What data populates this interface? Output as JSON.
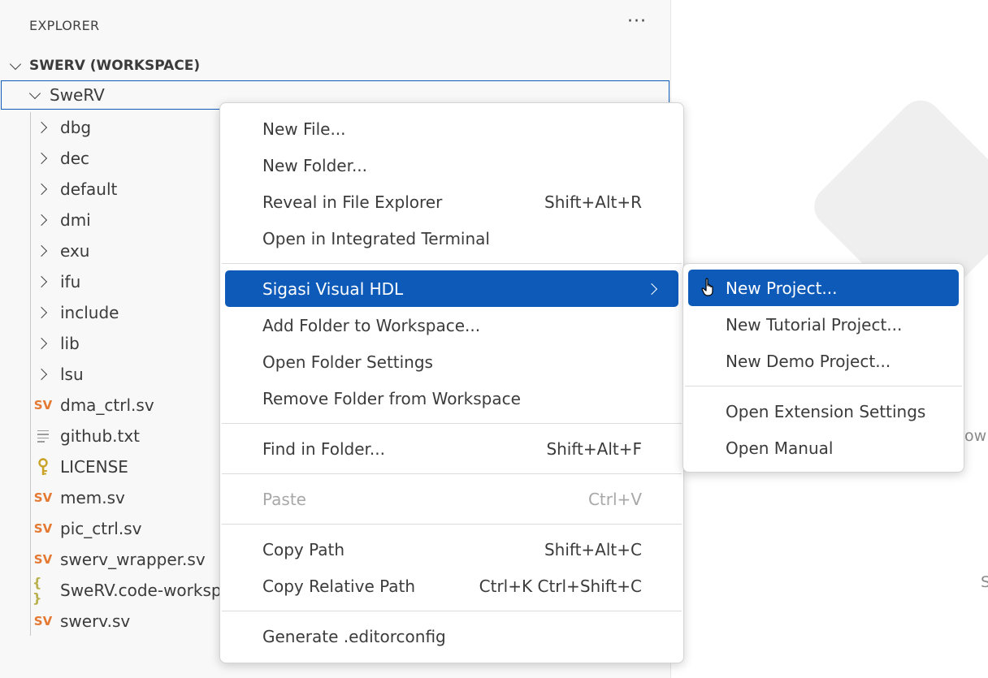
{
  "sidebar": {
    "header": "EXPLORER",
    "more_actions": "···",
    "workspace": "SWERV (WORKSPACE)",
    "root_folder": "SweRV",
    "items": [
      {
        "label": "dbg",
        "kind": "folder"
      },
      {
        "label": "dec",
        "kind": "folder"
      },
      {
        "label": "default",
        "kind": "folder"
      },
      {
        "label": "dmi",
        "kind": "folder"
      },
      {
        "label": "exu",
        "kind": "folder"
      },
      {
        "label": "ifu",
        "kind": "folder"
      },
      {
        "label": "include",
        "kind": "folder"
      },
      {
        "label": "lib",
        "kind": "folder"
      },
      {
        "label": "lsu",
        "kind": "folder"
      },
      {
        "label": "dma_ctrl.sv",
        "kind": "sv",
        "icon_text": "SV"
      },
      {
        "label": "github.txt",
        "kind": "txt"
      },
      {
        "label": "LICENSE",
        "kind": "license"
      },
      {
        "label": "mem.sv",
        "kind": "sv",
        "icon_text": "SV"
      },
      {
        "label": "pic_ctrl.sv",
        "kind": "sv",
        "icon_text": "SV"
      },
      {
        "label": "swerv_wrapper.sv",
        "kind": "sv",
        "icon_text": "SV"
      },
      {
        "label": "SweRV.code-worksp",
        "kind": "json",
        "icon_text": "{ }"
      },
      {
        "label": "swerv.sv",
        "kind": "sv",
        "icon_text": "SV"
      }
    ]
  },
  "editor": {
    "hint_1": "ow",
    "hint_2": "S"
  },
  "context_menu": {
    "groups": [
      [
        {
          "label": "New File...",
          "shortcut": ""
        },
        {
          "label": "New Folder...",
          "shortcut": ""
        },
        {
          "label": "Reveal in File Explorer",
          "shortcut": "Shift+Alt+R"
        },
        {
          "label": "Open in Integrated Terminal",
          "shortcut": ""
        }
      ],
      [
        {
          "label": "Sigasi Visual HDL",
          "shortcut": "",
          "submenu": true,
          "active": true
        },
        {
          "label": "Add Folder to Workspace...",
          "shortcut": ""
        },
        {
          "label": "Open Folder Settings",
          "shortcut": ""
        },
        {
          "label": "Remove Folder from Workspace",
          "shortcut": ""
        }
      ],
      [
        {
          "label": "Find in Folder...",
          "shortcut": "Shift+Alt+F"
        }
      ],
      [
        {
          "label": "Paste",
          "shortcut": "Ctrl+V",
          "disabled": true
        }
      ],
      [
        {
          "label": "Copy Path",
          "shortcut": "Shift+Alt+C"
        },
        {
          "label": "Copy Relative Path",
          "shortcut": "Ctrl+K Ctrl+Shift+C"
        }
      ],
      [
        {
          "label": "Generate .editorconfig",
          "shortcut": ""
        }
      ]
    ]
  },
  "submenu": {
    "groups": [
      [
        {
          "label": "New Project...",
          "active": true
        },
        {
          "label": "New Tutorial Project..."
        },
        {
          "label": "New Demo Project..."
        }
      ],
      [
        {
          "label": "Open Extension Settings"
        },
        {
          "label": "Open Manual"
        }
      ]
    ]
  },
  "colors": {
    "accent": "#0d5ab9",
    "sv_icon": "#e37933",
    "json_icon": "#b8b04a",
    "license_icon": "#c9a227"
  }
}
